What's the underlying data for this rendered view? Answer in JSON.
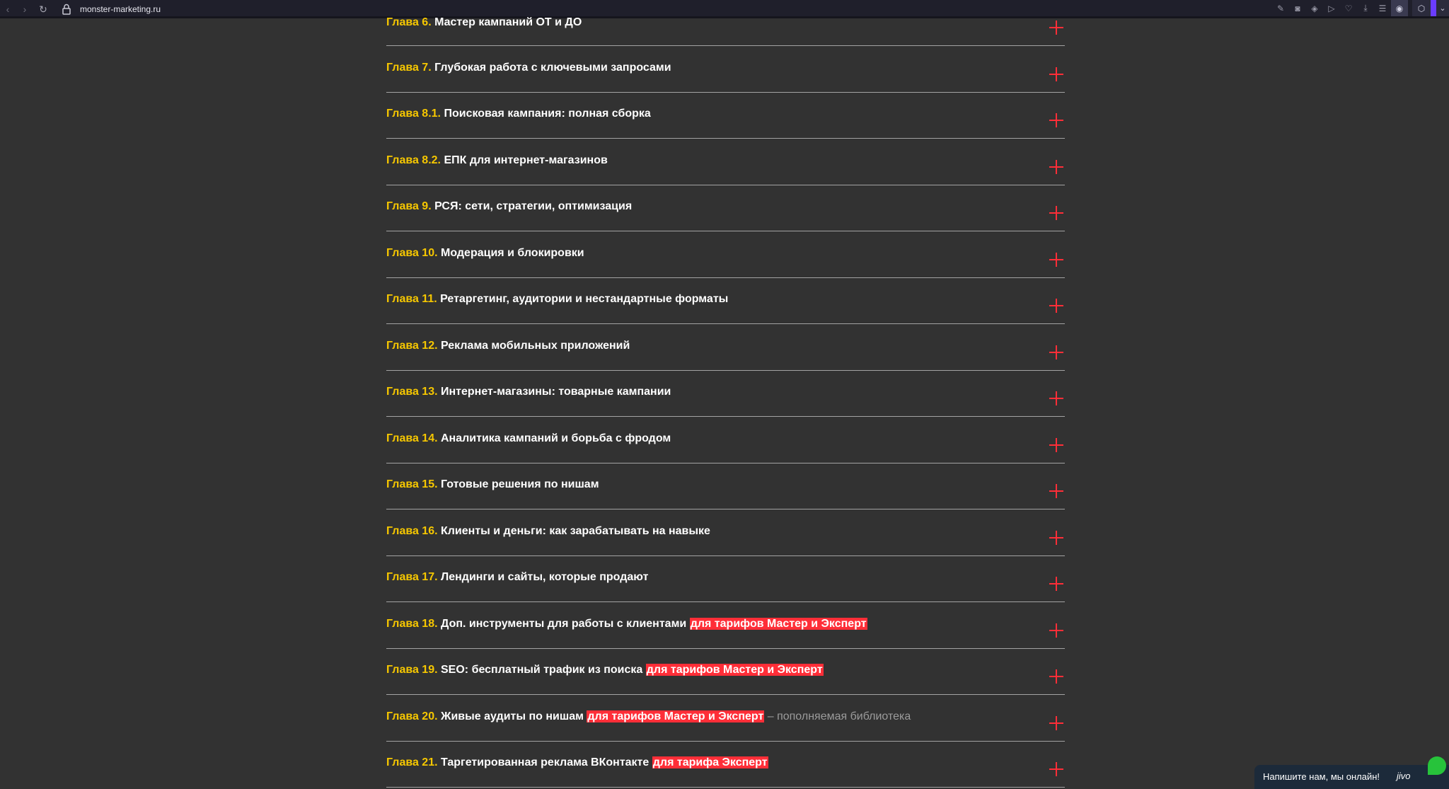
{
  "browser": {
    "back_icon": "‹",
    "forward_icon": "›",
    "reload_icon": "↻",
    "url": "monster-marketing.ru",
    "toolbar_icons": [
      "edit-icon",
      "camera-icon",
      "shield-icon",
      "play-icon",
      "heart-icon",
      "download-icon",
      "menu-icon",
      "profile-icon"
    ]
  },
  "chapters": [
    {
      "num": "Глава 6.",
      "title": "Мастер кампаний ОТ и ДО",
      "badge": "",
      "note": ""
    },
    {
      "num": "Глава 7.",
      "title": "Глубокая работа с ключевыми запросами",
      "badge": "",
      "note": ""
    },
    {
      "num": "Глава 8.1.",
      "title": "Поисковая кампания: полная сборка",
      "badge": "",
      "note": ""
    },
    {
      "num": "Глава 8.2.",
      "title": "ЕПК для интернет-магазинов",
      "badge": "",
      "note": ""
    },
    {
      "num": "Глава 9.",
      "title": "РСЯ: сети, стратегии, оптимизация",
      "badge": "",
      "note": ""
    },
    {
      "num": "Глава 10.",
      "title": "Модерация и блокировки",
      "badge": "",
      "note": ""
    },
    {
      "num": "Глава 11.",
      "title": "Ретаргетинг, аудитории и нестандартные форматы",
      "badge": "",
      "note": ""
    },
    {
      "num": "Глава 12.",
      "title": "Реклама мобильных приложений",
      "badge": "",
      "note": ""
    },
    {
      "num": "Глава 13.",
      "title": "Интернет-магазины: товарные кампании",
      "badge": "",
      "note": ""
    },
    {
      "num": "Глава 14.",
      "title": "Аналитика кампаний и борьба с фродом",
      "badge": "",
      "note": ""
    },
    {
      "num": "Глава 15.",
      "title": "Готовые решения по нишам",
      "badge": "",
      "note": ""
    },
    {
      "num": "Глава 16.",
      "title": "Клиенты и деньги: как зарабатывать на навыке",
      "badge": "",
      "note": ""
    },
    {
      "num": "Глава 17.",
      "title": "Лендинги и сайты, которые продают",
      "badge": "",
      "note": ""
    },
    {
      "num": "Глава 18.",
      "title": "Доп. инструменты для работы с клиентами",
      "badge": "для тарифов Мастер и Эксперт",
      "note": ""
    },
    {
      "num": "Глава 19.",
      "title": "SEO: бесплатный трафик из поиска",
      "badge": "для тарифов Мастер и Эксперт",
      "note": ""
    },
    {
      "num": "Глава 20.",
      "title": "Живые аудиты по нишам",
      "badge": "для тарифов Мастер и Эксперт",
      "note": "– пополняемая библиотека"
    },
    {
      "num": "Глава 21.",
      "title": "Таргетированная реклама ВКонтакте",
      "badge": "для тарифа Эксперт",
      "note": ""
    }
  ],
  "chat": {
    "text": "Напишите нам, мы онлайн!",
    "brand": "jivo"
  }
}
